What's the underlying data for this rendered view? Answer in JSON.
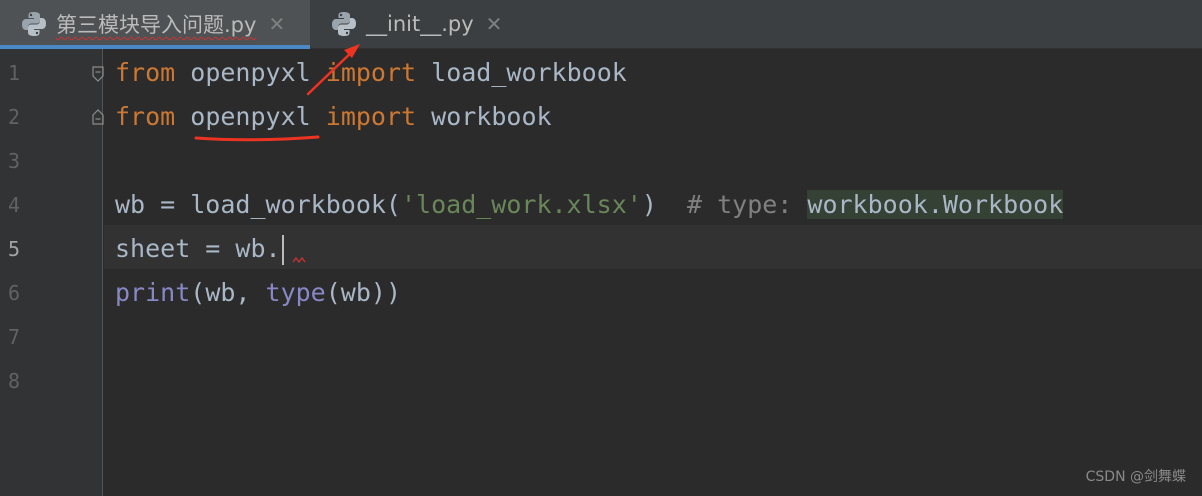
{
  "tabs": [
    {
      "label": "第三模块导入问题.py",
      "active": true
    },
    {
      "label": "__init__.py",
      "active": false
    }
  ],
  "line_numbers": [
    "1",
    "2",
    "3",
    "4",
    "5",
    "6",
    "7",
    "8"
  ],
  "code": {
    "l1": {
      "kw_from": "from",
      "module": "openpyxl",
      "kw_import": "import",
      "name": "load_workbook"
    },
    "l2": {
      "kw_from": "from",
      "module": "openpyxl",
      "kw_import": "import",
      "name": "workbook"
    },
    "l4": {
      "lhs": "wb = load_workbook(",
      "str": "'load_work.xlsx'",
      "close": ")",
      "comment": "# type: ",
      "type_hint": "workbook.Workbook"
    },
    "l5": {
      "text": "sheet = wb."
    },
    "l6": {
      "fn": "print",
      "open": "(wb, ",
      "bi": "type",
      "rest": "(wb))"
    }
  },
  "watermark": "CSDN @剑舞蝶",
  "colors": {
    "keyword": "#cc7832",
    "string": "#6a8759",
    "comment": "#808080",
    "builtin": "#8888c6",
    "annotation": "#ee3322",
    "tab_accent": "#4a88c7"
  }
}
